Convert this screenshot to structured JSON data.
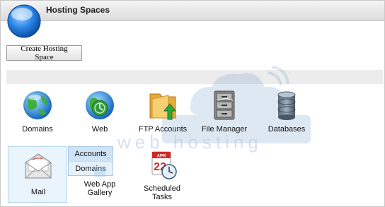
{
  "header": {
    "title": "Hosting Spaces"
  },
  "toolbar": {
    "create_label": "Create Hosting Space"
  },
  "watermark": {
    "brand": "web hosting"
  },
  "icons": {
    "domains": "Domains",
    "web": "Web",
    "ftp": "FTP Accounts",
    "file_manager": "File Manager",
    "databases": "Databases",
    "mail": "Mail",
    "web_app_gallery_line1": "Web App",
    "web_app_gallery_line2": "Gallery",
    "scheduled_line1": "Scheduled",
    "scheduled_line2": "Tasks"
  },
  "mail_submenu": {
    "accounts": "Accounts",
    "domains": "Domains"
  },
  "calendar": {
    "month": "APR",
    "day": "22"
  },
  "colors": {
    "accent": "#1e74d0",
    "highlight": "#eaf4fd",
    "header": "#dcdcdc"
  }
}
